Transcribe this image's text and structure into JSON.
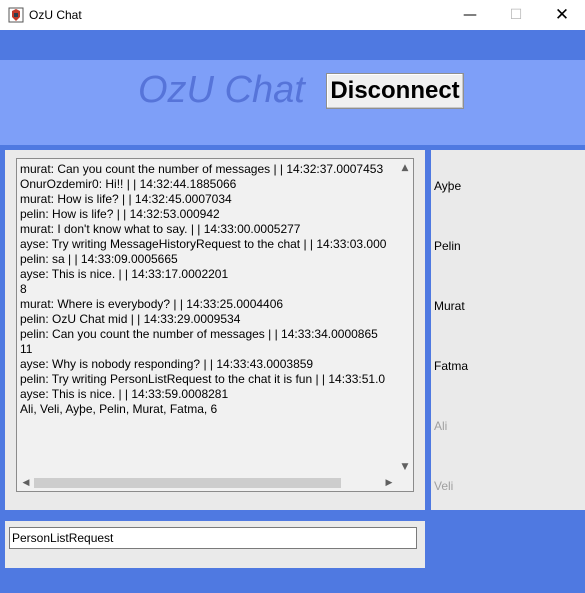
{
  "window": {
    "title": "OzU Chat",
    "icons": {
      "app": "java-app-icon",
      "minimize": "minimize-icon",
      "maximize": "maximize-icon",
      "close": "close-icon"
    },
    "minimize_glyph": "—",
    "maximize_glyph": "☐",
    "close_glyph": "✕"
  },
  "header": {
    "title": "OzU Chat",
    "disconnect_label": "Disconnect"
  },
  "colors": {
    "band_blue": "#4f79e1",
    "header_blue": "#7e9ff8",
    "title_blue": "#5674d9",
    "panel_gray": "#eaeaea"
  },
  "messages": [
    "murat: Can you count the number of messages |  | 14:32:37.0007453",
    "OnurOzdemir0: Hi!! |  | 14:32:44.1885066",
    "murat: How is life? |  | 14:32:45.0007034",
    "pelin: How is life? |  | 14:32:53.000942",
    "murat: I don't know what to say. |  | 14:33:00.0005277",
    "ayse: Try writing MessageHistoryRequest to the chat |  | 14:33:03.000",
    "pelin: sa |  | 14:33:09.0005665",
    "ayse: This is nice. |  | 14:33:17.0002201",
    "8",
    "murat: Where is everybody? |  | 14:33:25.0004406",
    "pelin: OzU Chat mid |  | 14:33:29.0009534",
    "pelin: Can you count the number of messages |  | 14:33:34.0000865",
    "11",
    "ayse: Why is nobody responding? |  | 14:33:43.0003859",
    "pelin: Try writing PersonListRequest to the chat it is fun |  | 14:33:51.0",
    "ayse: This is nice. |  | 14:33:59.0008281",
    "Ali, Veli, Ayþe, Pelin, Murat, Fatma, 6"
  ],
  "scrollbar": {
    "up_glyph": "▲",
    "down_glyph": "▼",
    "left_glyph": "◀",
    "right_glyph": "▶"
  },
  "people": [
    {
      "name": "Ayþe",
      "color": "#000000"
    },
    {
      "name": "Pelin",
      "color": "#000000"
    },
    {
      "name": "Murat",
      "color": "#000000"
    },
    {
      "name": "Fatma",
      "color": "#000000"
    },
    {
      "name": "Ali",
      "color": "#a0a0a0"
    },
    {
      "name": "Veli",
      "color": "#a0a0a0"
    }
  ],
  "input": {
    "value": "PersonListRequest"
  }
}
